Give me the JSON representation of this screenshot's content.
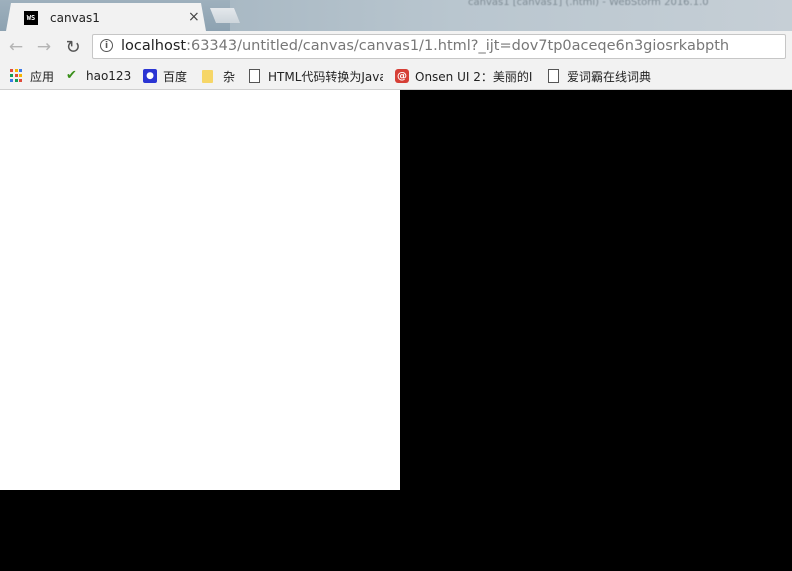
{
  "tab": {
    "title": "canvas1",
    "favicon_text": "WS",
    "close_glyph": "×"
  },
  "background_window_title": "canvas1 [canvas1] (.html) - WebStorm 2016.1.0",
  "toolbar": {
    "back_glyph": "←",
    "forward_glyph": "→",
    "reload_glyph": "↻"
  },
  "omnibox": {
    "info_glyph": "i",
    "url_host": "localhost",
    "url_rest": ":63343/untitled/canvas/canvas1/1.html?_ijt=dov7tp0aceqe6n3giosrkabpth"
  },
  "bookmarks": [
    {
      "label": "应用",
      "icon": "apps-grid-icon"
    },
    {
      "label": "hao123",
      "icon": "hao123-icon"
    },
    {
      "label": "百度",
      "icon": "baidu-paw-icon"
    },
    {
      "label": "杂",
      "icon": "folder-icon"
    },
    {
      "label": "HTML代码转换为Java",
      "icon": "page-icon"
    },
    {
      "label": "Onsen UI 2：美丽的I",
      "icon": "onsen-icon"
    },
    {
      "label": "爱词霸在线词典",
      "icon": "page-icon"
    }
  ],
  "colors": {
    "page_background": "#000000",
    "canvas_fill": "#ffffff"
  }
}
